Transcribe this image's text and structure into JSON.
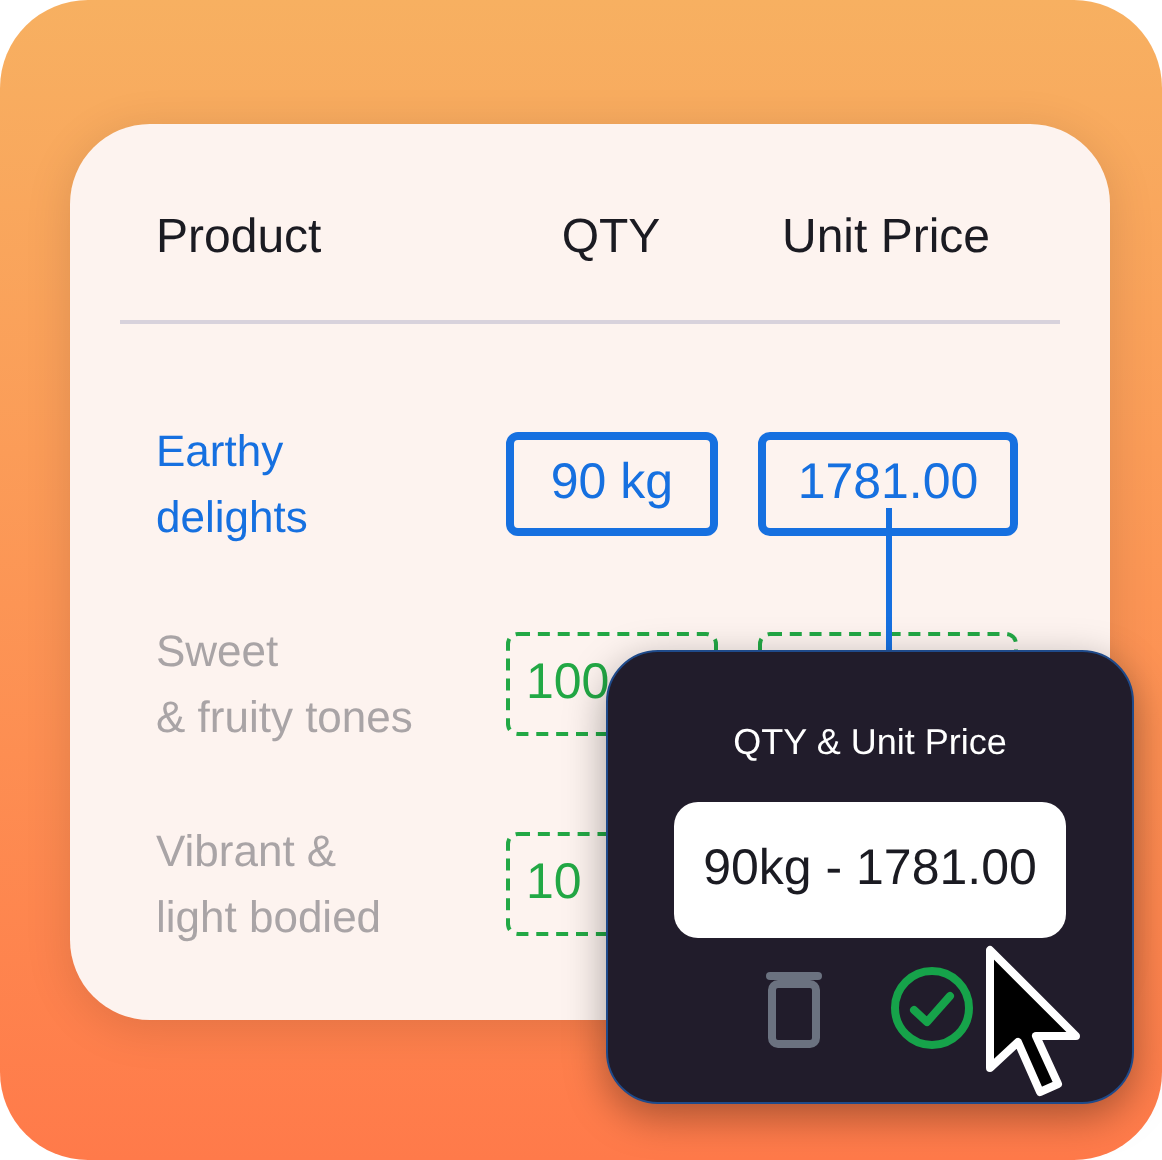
{
  "table": {
    "columns": [
      "Product",
      "QTY",
      "Unit Price"
    ],
    "rows": [
      {
        "product": [
          "Earthy",
          "delights"
        ],
        "qty": "90 kg",
        "unit_price": "1781.00",
        "selected": true
      },
      {
        "product": [
          "Sweet",
          "& fruity tones"
        ],
        "qty": "100",
        "selected": false
      },
      {
        "product": [
          "Vibrant &",
          "light bodied"
        ],
        "qty": "10",
        "selected": false
      }
    ]
  },
  "popup": {
    "title": "QTY & Unit Price",
    "value": "90kg - 1781.00"
  }
}
